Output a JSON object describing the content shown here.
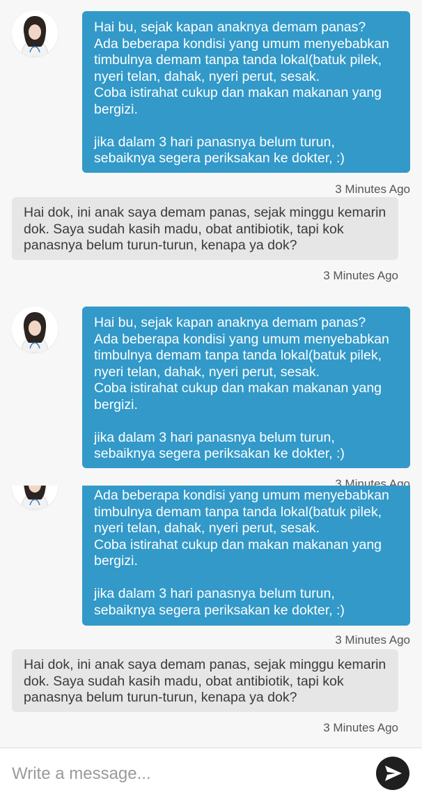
{
  "messages": [
    {
      "doctor_text": "Hai bu, sejak kapan anaknya demam panas?\nAda beberapa kondisi yang umum menyebabkan timbulnya demam tanpa tanda lokal(batuk pilek, nyeri telan, dahak, nyeri perut, sesak.\nCoba istirahat cukup dan makan makanan yang bergizi.\n\n jika dalam 3 hari panasnya belum turun, sebaiknya segera periksakan ke dokter, :)",
      "doctor_time": "3 Minutes Ago",
      "user_text": "Hai dok, ini anak saya demam panas, sejak minggu kemarin dok. Saya sudah kasih madu, obat antibiotik, tapi kok panasnya belum turun-turun, kenapa ya dok?",
      "user_time": "3 Minutes Ago"
    },
    {
      "doctor_text": "Hai bu, sejak kapan anaknya demam panas?\nAda beberapa kondisi yang umum menyebabkan timbulnya demam tanpa tanda lokal(batuk pilek, nyeri telan, dahak, nyeri perut, sesak.\nCoba istirahat cukup dan makan makanan yang bergizi.\n\n jika dalam 3 hari panasnya belum turun, sebaiknya segera periksakan ke dokter, :)",
      "doctor_time": "3 Minutes Ago"
    },
    {
      "doctor_text_visible": "Ada beberapa kondisi yang umum menyebabkan timbulnya demam tanpa tanda lokal(batuk pilek, nyeri telan, dahak, nyeri perut, sesak.\nCoba istirahat cukup dan makan makanan yang bergizi.\n\n jika dalam 3 hari panasnya belum turun, sebaiknya segera periksakan ke dokter, :)",
      "doctor_time": "3 Minutes Ago",
      "user_text": "Hai dok, ini anak saya demam panas, sejak minggu kemarin dok. Saya sudah kasih madu, obat antibiotik, tapi kok panasnya belum turun-turun, kenapa ya dok?",
      "user_time": "3 Minutes Ago"
    }
  ],
  "overlap_time": "3 Minutes Ago",
  "composer": {
    "placeholder": "Write a message...",
    "send_icon": "send-arrow-icon"
  },
  "colors": {
    "doctor_bubble": "#3299c9",
    "user_bubble": "#e6e6e6",
    "background": "#f7f7f7",
    "send_button": "#1f1f1f"
  }
}
